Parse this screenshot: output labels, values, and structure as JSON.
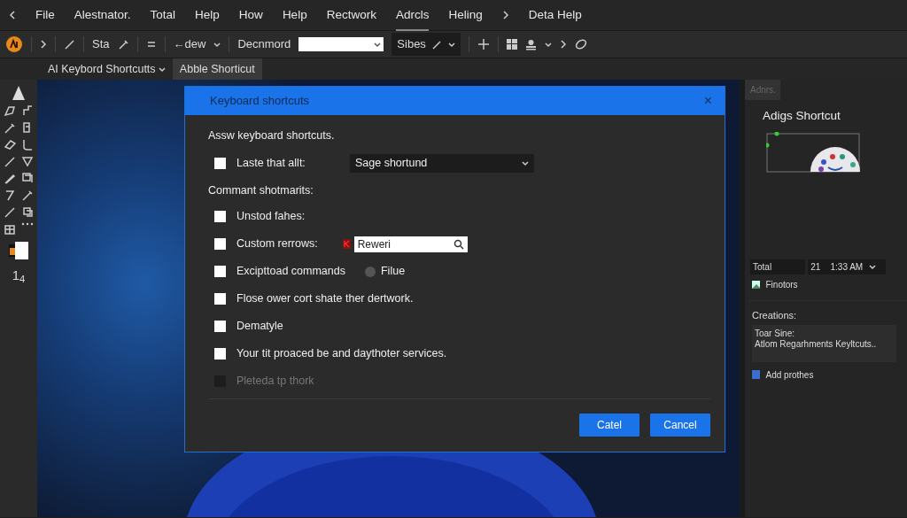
{
  "menu": [
    {
      "label": "File",
      "selected": false
    },
    {
      "label": "Alestnator.",
      "selected": false
    },
    {
      "label": "Total",
      "selected": false
    },
    {
      "label": "Help",
      "selected": false
    },
    {
      "label": "How",
      "selected": false
    },
    {
      "label": "Help",
      "selected": false
    },
    {
      "label": "Rectwork",
      "selected": false
    },
    {
      "label": "Adrcls",
      "selected": true
    },
    {
      "label": "Heling",
      "selected": false
    },
    {
      "label": "Deta Help",
      "selected": false
    }
  ],
  "toolbar": {
    "label": "Sta",
    "zoom": "←dew",
    "document_label": "Decnmord",
    "sizes": "Sibes"
  },
  "doc_tabs": [
    {
      "label": "AI Keybord Shortcutts",
      "selected": false
    },
    {
      "label": "Abble Shorticut",
      "selected": true
    }
  ],
  "tools_counter": "1$_{4}$",
  "dialog": {
    "title": "Keyboard shortcuts",
    "close": "×",
    "intro": "Assw keyboard shortcuts.",
    "first_option": {
      "label": "Laste that allt:",
      "checked": false,
      "value": "Sage shortund"
    },
    "section": "Commant shotmarits:",
    "options": [
      {
        "kind": "plain",
        "label": "Unstod fahes:",
        "checked": false,
        "disabled": false
      },
      {
        "kind": "search",
        "label": "Custom rerrows:",
        "checked": false,
        "disabled": false,
        "value": "Reweri"
      },
      {
        "kind": "radio",
        "label": "Excipttoad commands",
        "checked": false,
        "disabled": false,
        "radio_label": "Filue",
        "radio_selected": false
      },
      {
        "kind": "plain",
        "label": "Flose ower cort shate ther dertwork.",
        "checked": false,
        "disabled": false
      },
      {
        "kind": "plain",
        "label": "Dematyle",
        "checked": false,
        "disabled": false
      },
      {
        "kind": "plain",
        "label": "Your tit proaced be and daythoter services.",
        "checked": false,
        "disabled": false
      },
      {
        "kind": "plain",
        "label": "Pleteda tp thork",
        "checked": false,
        "disabled": true
      }
    ],
    "buttons": [
      "Catel",
      "Cancel"
    ]
  },
  "panel": {
    "tab": "Adnrs.",
    "title": "Adigs Shortcut",
    "field_1": "Total",
    "field_2": "21",
    "time": "1:33 AM",
    "photos": "Finotors",
    "creations_label": "Creations:",
    "notes": [
      "Toar Sine:",
      "Atlom Regarhments Keyltcuts.."
    ],
    "add": "Add prothes"
  }
}
